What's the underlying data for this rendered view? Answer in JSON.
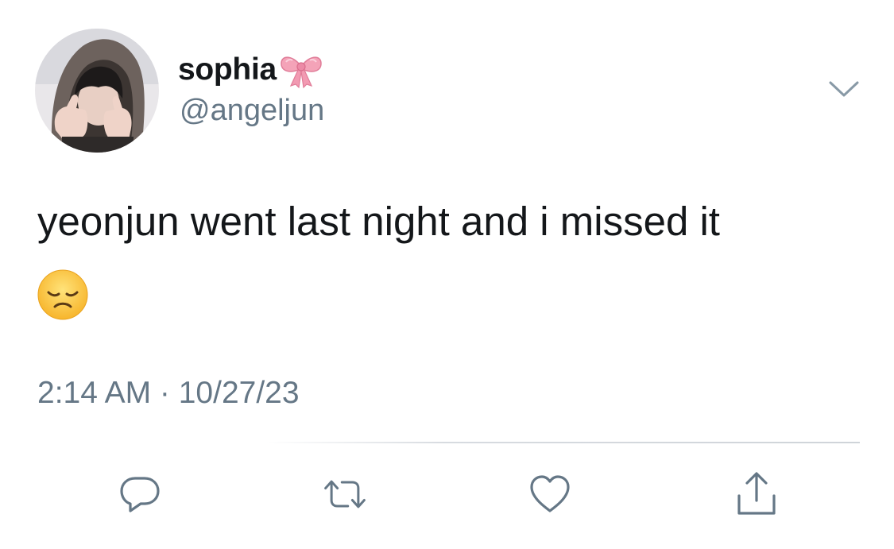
{
  "tweet": {
    "display_name": "sophia",
    "name_emoji": "ribbon-bow-emoji",
    "handle": "@angeljun",
    "text": "yeonjun went last night and i missed it",
    "emoji": "disappointed-face-emoji",
    "timestamp": "2:14 AM · 10/27/23"
  },
  "actions": [
    {
      "icon": "reply-icon"
    },
    {
      "icon": "retweet-icon"
    },
    {
      "icon": "like-icon"
    },
    {
      "icon": "share-icon"
    }
  ],
  "colors": {
    "text_primary": "#14171a",
    "text_secondary": "#657786",
    "icon_gray": "#657786",
    "divider": "#cfd4d9",
    "bow_pink": "#f4a3b8",
    "emoji_yellow": "#ffcc4d"
  }
}
